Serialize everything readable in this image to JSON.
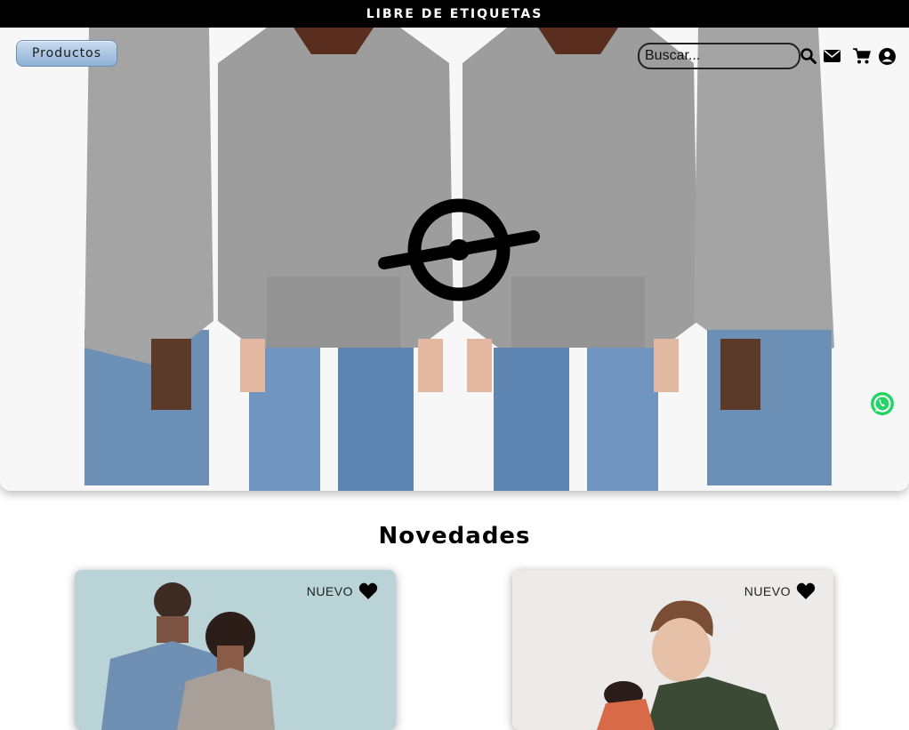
{
  "topbar": {
    "brand": "LIBRE DE ETIQUETAS"
  },
  "nav": {
    "products_label": "Productos",
    "search_placeholder": "Buscar...",
    "icons": [
      "search-icon",
      "mail-icon",
      "cart-icon",
      "user-icon"
    ]
  },
  "hero": {
    "logo_icon": "eye-logo-icon"
  },
  "floating": {
    "icon": "whatsapp-icon"
  },
  "novedades": {
    "title": "Novedades",
    "cards": [
      {
        "badge": "NUEVO",
        "icon": "heart-icon"
      },
      {
        "badge": "NUEVO",
        "icon": "heart-icon"
      }
    ]
  },
  "colors": {
    "topbar_bg": "#000000",
    "button_blue": "#8fb2d6",
    "whatsapp_green": "#25d366"
  }
}
